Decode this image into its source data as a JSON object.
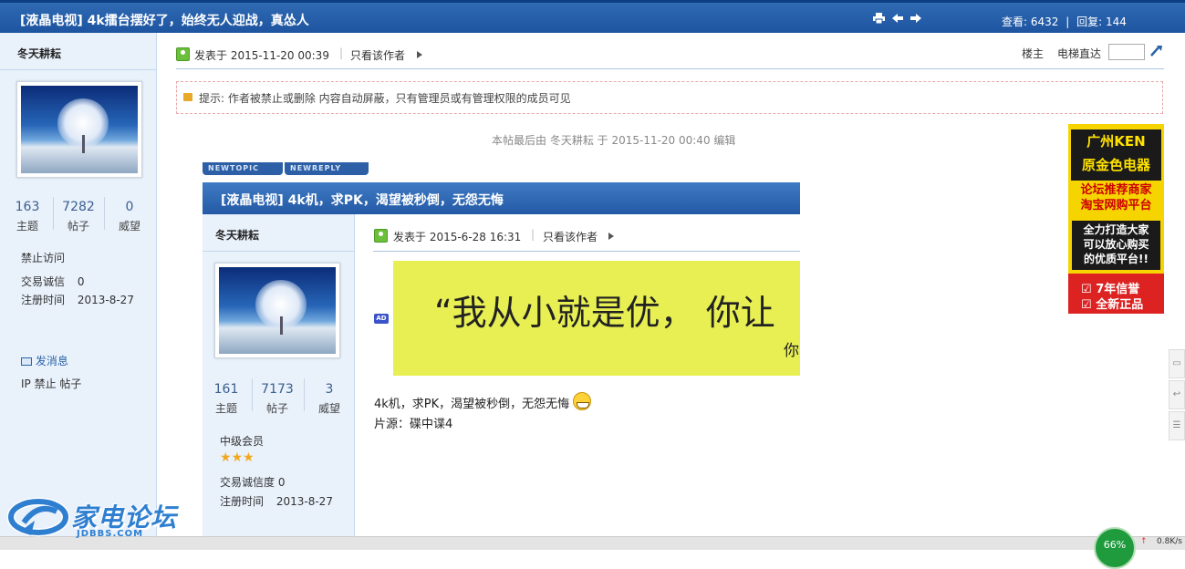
{
  "header": {
    "title": "[液晶电视] 4k擂台摆好了，始终无人迎战，真怂人",
    "views_label": "查看:",
    "views": "6432",
    "replies_label": "回复:",
    "replies": "144",
    "separator": "|"
  },
  "author": {
    "name": "冬天耕耘",
    "stats": [
      {
        "value": "163",
        "label": "主题"
      },
      {
        "value": "7282",
        "label": "帖子"
      },
      {
        "value": "0",
        "label": "威望"
      }
    ],
    "status": "禁止访问",
    "credit_label": "交易诚信",
    "credit_value": "0",
    "reg_label": "注册时间",
    "reg_value": "2013-8-27",
    "send_msg": "发消息",
    "ip_ban": "IP 禁止 帖子"
  },
  "post": {
    "posted_at": "发表于 2015-11-20 00:39",
    "only_author": "只看该作者",
    "floor_label": "楼主",
    "elevator_label": "电梯直达",
    "notice": "提示: 作者被禁止或删除 内容自动屏蔽，只有管理员或有管理权限的成员可见",
    "edited": "本帖最后由 冬天耕耘 于 2015-11-20 00:40 编辑"
  },
  "embed": {
    "btn_newtopic": "NEWTOPIC",
    "btn_newreply": "NEWREPLY",
    "title": "[液晶电视] 4k机，求PK，渴望被秒倒，无怨无悔",
    "author": {
      "name": "冬天耕耘",
      "stats": [
        {
          "value": "161",
          "label": "主题"
        },
        {
          "value": "7173",
          "label": "帖子"
        },
        {
          "value": "3",
          "label": "威望"
        }
      ],
      "rank": "中级会员",
      "credit": "交易诚信度 0",
      "reg_label": "注册时间",
      "reg_value": "2013-8-27"
    },
    "posted_at": "发表于 2015-6-28 16:31",
    "only_author": "只看该作者",
    "ad_badge": "AD",
    "ad_text": "“我从小就是优， 你让",
    "ad_text2": "你",
    "body_line1": "4k机，求PK，渴望被秒倒，无怨无悔",
    "body_line2": "片源：碟中谍4"
  },
  "right_ad": {
    "line1": "广州KEN",
    "line2": "原金色电器",
    "line3": "论坛推荐商家",
    "line4": "淘宝网购平台",
    "box1": "全力打造大家",
    "box2": "可以放心购买",
    "box3": "的优质平台!!",
    "bot1": "7年信誉",
    "bot2": "全新正品"
  },
  "footer": {
    "logo_text": "家电论坛",
    "logo_sub": "JDBBS.COM",
    "gauge": "66%",
    "netspeed": "0.8K/s"
  },
  "colors": {
    "header_blue": "#1e54a0",
    "sidebar_bg": "#e9f1fb",
    "link_blue": "#2a64a8",
    "ad_yellow": "#e7ef53"
  }
}
